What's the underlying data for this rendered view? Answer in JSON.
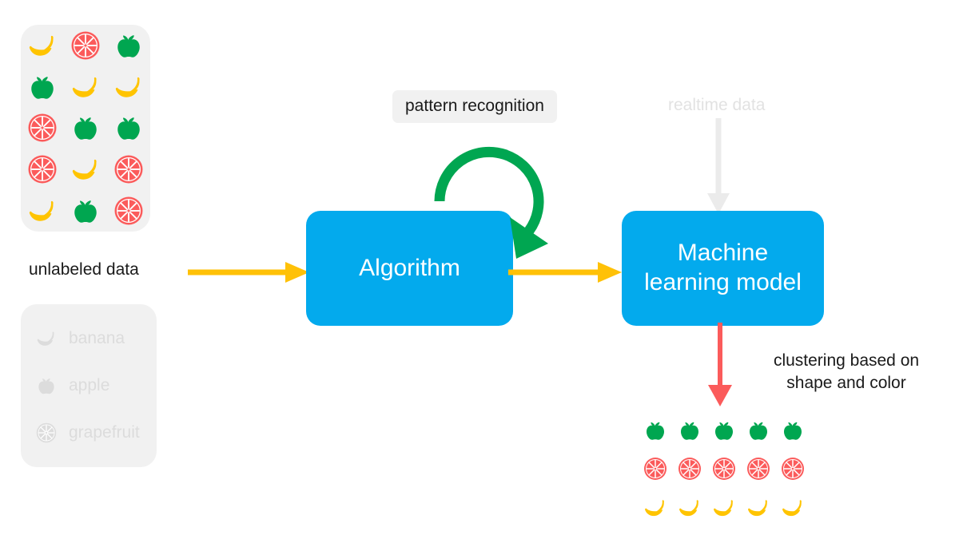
{
  "diagram": {
    "title_text_visible": false,
    "background": "#ffffff"
  },
  "colors": {
    "box_blue": "#03aaed",
    "arrow_yellow": "#ffc107",
    "arrow_green": "#00a651",
    "arrow_red": "#fb5b5b",
    "arrow_gray": "#ebebeb",
    "card_gray": "#f1f1f1",
    "fruit_banana": "#ffc400",
    "fruit_apple": "#00a650",
    "fruit_grapefruit": "#fb5b5b",
    "text_dark": "#1a1a1a",
    "text_faded": "#dcdcdc"
  },
  "input_card": {
    "name": "unlabeled data sample grid",
    "columns": 3,
    "rows": 5,
    "fruits": [
      "banana",
      "grapefruit",
      "apple",
      "apple",
      "banana",
      "banana",
      "grapefruit",
      "apple",
      "apple",
      "grapefruit",
      "banana",
      "grapefruit",
      "banana",
      "apple",
      "grapefruit"
    ]
  },
  "legend_card": {
    "items": [
      {
        "icon": "banana-icon",
        "label": "banana"
      },
      {
        "icon": "apple-icon",
        "label": "apple"
      },
      {
        "icon": "grapefruit-icon",
        "label": "grapefruit"
      }
    ]
  },
  "labels": {
    "unlabeled_data": "unlabeled data",
    "pattern_recognition": "pattern recognition",
    "realtime_data": "realtime data",
    "clustering": "clustering based on\nshape and color"
  },
  "boxes": {
    "algorithm": "Algorithm",
    "model": "Machine\nlearning model"
  },
  "arrows": [
    {
      "name": "unlabeled-data-arrow",
      "color": "#ffc107",
      "direction": "right",
      "from": "unlabeled data",
      "to": "Algorithm"
    },
    {
      "name": "algorithm-to-model-arrow",
      "color": "#ffc107",
      "direction": "right",
      "from": "Algorithm",
      "to": "Machine learning model"
    },
    {
      "name": "pattern-recognition-loop-arrow",
      "color": "#00a651",
      "direction": "clockwise-arc",
      "label": "pattern recognition"
    },
    {
      "name": "realtime-data-arrow",
      "color": "#ebebeb",
      "direction": "down",
      "label": "realtime data"
    },
    {
      "name": "clustering-output-arrow",
      "color": "#fb5b5b",
      "direction": "down",
      "label": "clustering based on shape and color"
    }
  ],
  "output_clusters": {
    "columns": 5,
    "rows": 3,
    "groups": [
      {
        "fruit": "apple",
        "count": 5
      },
      {
        "fruit": "grapefruit",
        "count": 5
      },
      {
        "fruit": "banana",
        "count": 5
      }
    ],
    "fruits": [
      "apple",
      "apple",
      "apple",
      "apple",
      "apple",
      "grapefruit",
      "grapefruit",
      "grapefruit",
      "grapefruit",
      "grapefruit",
      "banana",
      "banana",
      "banana",
      "banana",
      "banana"
    ]
  }
}
